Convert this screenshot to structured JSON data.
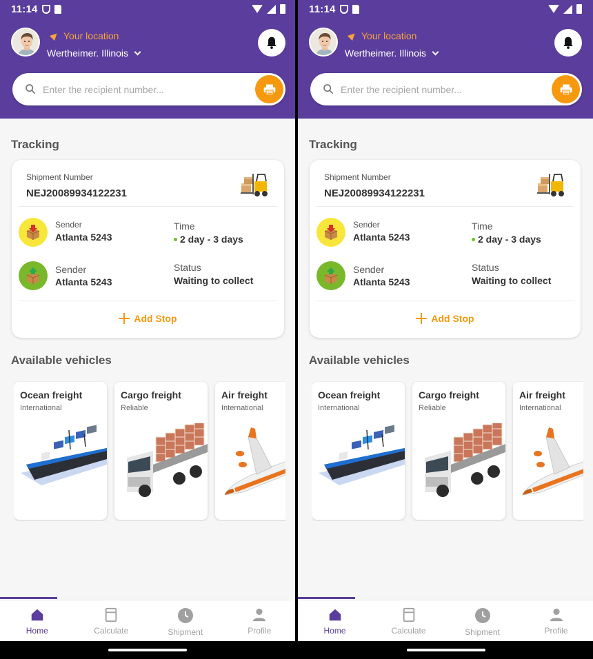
{
  "status_bar": {
    "time": "11:14"
  },
  "header": {
    "location_label": "Your location",
    "city": "Wertheimer. Illinois"
  },
  "search": {
    "placeholder": "Enter the recipient number..."
  },
  "tracking": {
    "title": "Tracking",
    "shipment_number_label": "Shipment Number",
    "shipment_number": "NEJ20089934122231",
    "sender1_label": "Sender",
    "sender1_value": "Atlanta 5243",
    "time_label": "Time",
    "time_value": "2 day - 3 days",
    "sender2_label": "Sender",
    "sender2_value": "Atlanta 5243",
    "status_label": "Status",
    "status_value": "Waiting to collect",
    "add_stop": "Add Stop"
  },
  "vehicles": {
    "title": "Available vehicles",
    "items": [
      {
        "title": "Ocean freight",
        "subtitle": "International",
        "icon": "ship-icon"
      },
      {
        "title": "Cargo freight",
        "subtitle": "Reliable",
        "icon": "truck-icon"
      },
      {
        "title": "Air freight",
        "subtitle": "International",
        "icon": "airplane-icon"
      }
    ]
  },
  "nav": {
    "items": [
      {
        "label": "Home",
        "icon": "home-icon",
        "active": true
      },
      {
        "label": "Calculate",
        "icon": "calculator-icon",
        "active": false
      },
      {
        "label": "Shipment",
        "icon": "clock-icon",
        "active": false
      },
      {
        "label": "Profile",
        "icon": "person-icon",
        "active": false
      }
    ]
  },
  "colors": {
    "primary": "#5a3d9d",
    "accent": "#f6990f",
    "location_label": "#f7a43a",
    "sender_yellow": "#f9e63a",
    "sender_green": "#79b82a",
    "time_dot": "#6cc223"
  }
}
